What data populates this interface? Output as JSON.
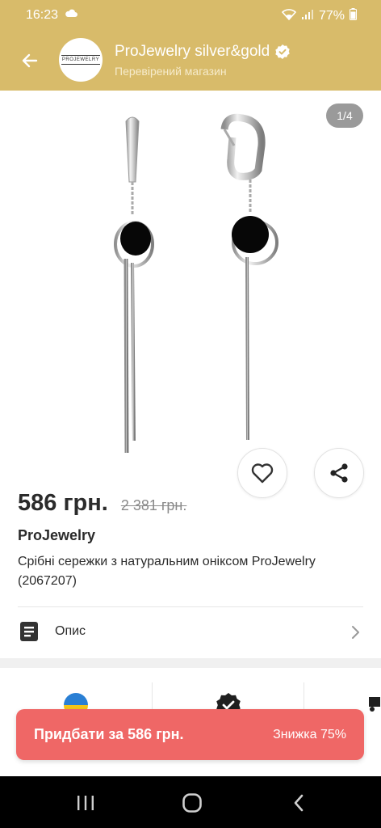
{
  "status": {
    "time": "16:23",
    "battery": "77%"
  },
  "header": {
    "shop_name": "ProJewelry silver&gold",
    "shop_subtitle": "Перевірений магазин",
    "logo_text": "PROJEWELRY"
  },
  "gallery": {
    "counter": "1/4"
  },
  "product": {
    "price": "586 грн.",
    "old_price": "2 381 грн.",
    "brand": "ProJewelry",
    "title": "Срібні сережки з натуральним оніксом ProJewelry (2067207)"
  },
  "description": {
    "label": "Опис"
  },
  "buy_bar": {
    "label": "Придбати за 586 грн.",
    "discount": "Знижка 75%"
  },
  "colors": {
    "header": "#d8bb6a",
    "buy": "#ef6766"
  }
}
